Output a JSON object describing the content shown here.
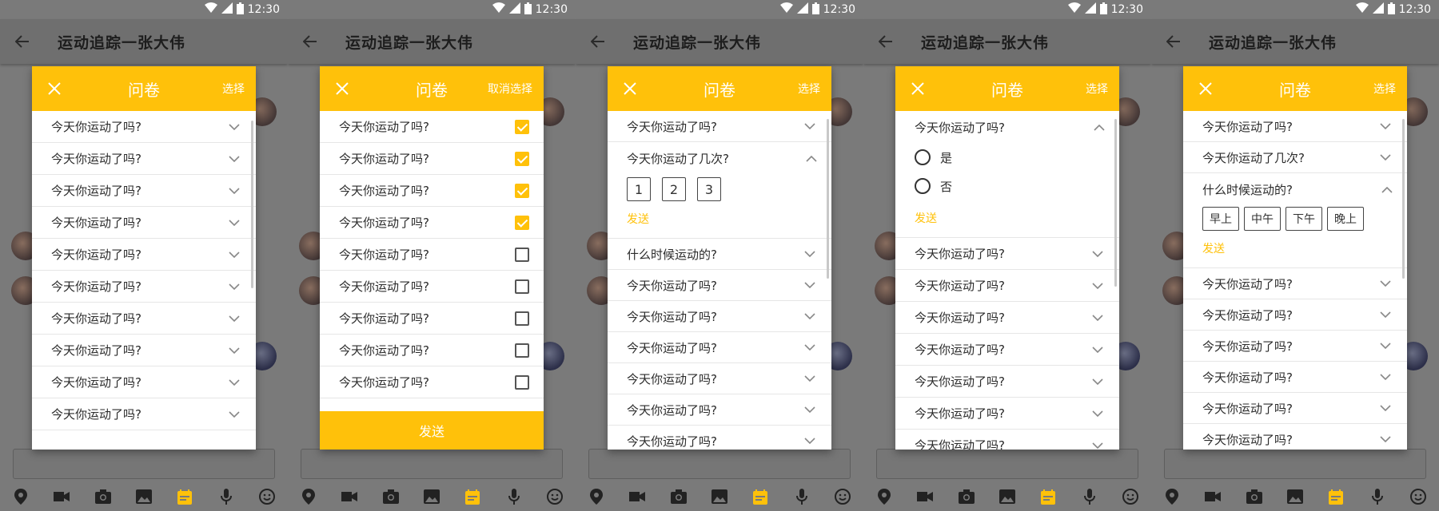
{
  "status": {
    "time": "12:30"
  },
  "app": {
    "title": "运动追踪一张大伟"
  },
  "colors": {
    "accent": "#ffc10a",
    "overlay": "#6e6e6e"
  },
  "icons": {
    "bottom": [
      "location-icon",
      "video-icon",
      "camera-icon",
      "image-icon",
      "calendar-icon",
      "mic-icon",
      "emoji-icon"
    ]
  },
  "screens": [
    {
      "dialog_title": "问卷",
      "action": "选择",
      "items": [
        "今天你运动了吗?",
        "今天你运动了吗?",
        "今天你运动了吗?",
        "今天你运动了吗?",
        "今天你运动了吗?",
        "今天你运动了吗?",
        "今天你运动了吗?",
        "今天你运动了吗?",
        "今天你运动了吗?",
        "今天你运动了吗?"
      ]
    },
    {
      "dialog_title": "问卷",
      "action": "取消选择",
      "items": [
        "今天你运动了吗?",
        "今天你运动了吗?",
        "今天你运动了吗?",
        "今天你运动了吗?",
        "今天你运动了吗?",
        "今天你运动了吗?",
        "今天你运动了吗?",
        "今天你运动了吗?",
        "今天你运动了吗?"
      ],
      "checked": [
        true,
        true,
        true,
        true,
        false,
        false,
        false,
        false,
        false
      ],
      "send_label": "发送"
    },
    {
      "dialog_title": "问卷",
      "action": "选择",
      "first": "今天你运动了吗?",
      "expanded_q": "今天你运动了几次?",
      "options": [
        "1",
        "2",
        "3"
      ],
      "send_label": "发送",
      "after": [
        "什么时候运动的?",
        "今天你运动了吗?",
        "今天你运动了吗?",
        "今天你运动了吗?",
        "今天你运动了吗?",
        "今天你运动了吗?",
        "今天你运动了吗?"
      ]
    },
    {
      "dialog_title": "问卷",
      "action": "选择",
      "expanded_q": "今天你运动了吗?",
      "radios": [
        "是",
        "否"
      ],
      "send_label": "发送",
      "after": [
        "今天你运动了吗?",
        "今天你运动了吗?",
        "今天你运动了吗?",
        "今天你运动了吗?",
        "今天你运动了吗?",
        "今天你运动了吗?",
        "今天你运动了吗?"
      ]
    },
    {
      "dialog_title": "问卷",
      "action": "选择",
      "before": [
        "今天你运动了吗?",
        "今天你运动了几次?"
      ],
      "expanded_q": "什么时候运动的?",
      "tags": [
        "早上",
        "中午",
        "下午",
        "晚上"
      ],
      "send_label": "发送",
      "after": [
        "今天你运动了吗?",
        "今天你运动了吗?",
        "今天你运动了吗?",
        "今天你运动了吗?",
        "今天你运动了吗?",
        "今天你运动了吗?"
      ]
    }
  ]
}
